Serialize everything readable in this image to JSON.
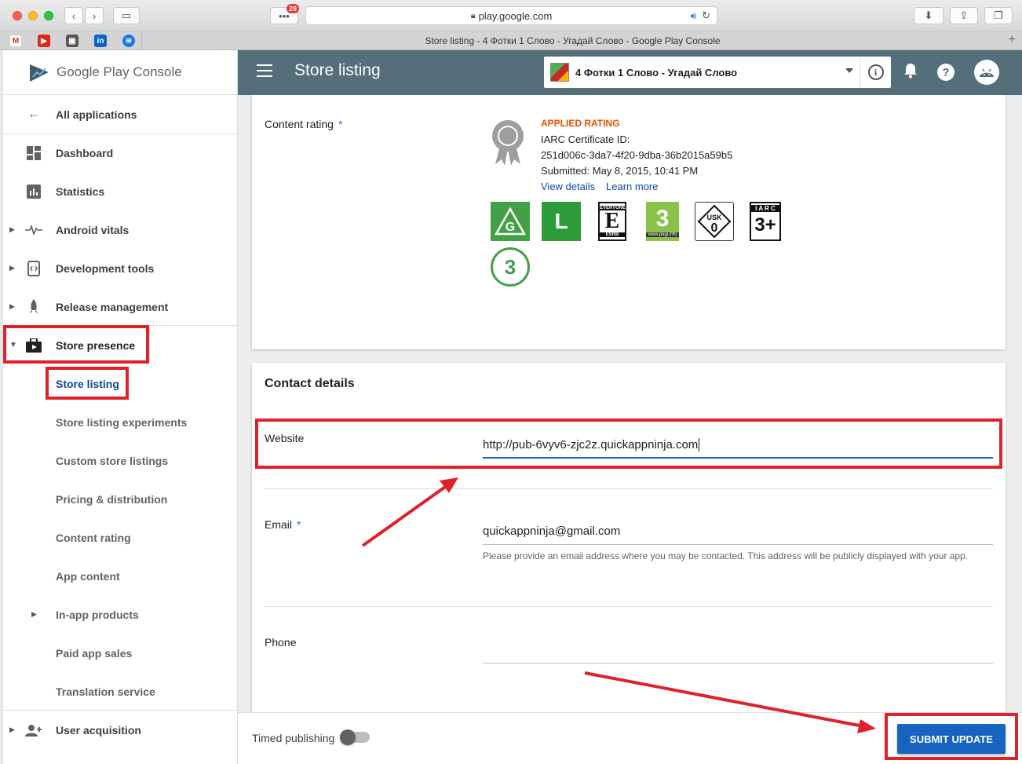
{
  "browser": {
    "url": "play.google.com",
    "tab_title": "Store listing - 4 Фотки 1 Слово - Угадай Слово - Google Play Console",
    "notification_count": "28"
  },
  "brand": {
    "name": "Google Play",
    "suffix": "Console"
  },
  "header": {
    "title": "Store listing",
    "app_name": "4 Фотки 1 Слово - Угадай Слово"
  },
  "sidebar": {
    "items": [
      {
        "label": "All applications"
      },
      {
        "label": "Dashboard"
      },
      {
        "label": "Statistics"
      },
      {
        "label": "Android vitals"
      },
      {
        "label": "Development tools"
      },
      {
        "label": "Release management"
      },
      {
        "label": "Store presence"
      },
      {
        "label": "Store listing"
      },
      {
        "label": "Store listing experiments"
      },
      {
        "label": "Custom store listings"
      },
      {
        "label": "Pricing & distribution"
      },
      {
        "label": "Content rating"
      },
      {
        "label": "App content"
      },
      {
        "label": "In-app products"
      },
      {
        "label": "Paid app sales"
      },
      {
        "label": "Translation service"
      },
      {
        "label": "User acquisition"
      }
    ]
  },
  "content_rating": {
    "label": "Content rating",
    "required_mark": "*",
    "status": "APPLIED RATING",
    "cert_label": "IARC Certificate ID:",
    "cert_id": "251d006c-3da7-4f20-9dba-36b2015a59b5",
    "submitted": "Submitted: May 8, 2015, 10:41 PM",
    "view_details": "View details",
    "learn_more": "Learn more",
    "badges": {
      "g": "G",
      "l": "L",
      "esrb_top": "EVERYONE",
      "esrb_letter": "E",
      "esrb_bottom": "ESRB",
      "pegi": "3",
      "pegi_url": "www.pegi.info",
      "usk_top": "USK",
      "usk_num": "0",
      "iarc_top": "I A R C",
      "iarc_num": "3+",
      "circle": "3"
    }
  },
  "contact": {
    "title": "Contact details",
    "website_label": "Website",
    "website_value": "http://pub-6vyv6-zjc2z.quickappninja.com",
    "email_label": "Email",
    "email_value": "quickappninja@gmail.com",
    "email_hint": "Please provide an email address where you may be contacted. This address will be publicly displayed with your app.",
    "phone_label": "Phone",
    "phone_value": ""
  },
  "footer": {
    "timed_publishing": "Timed publishing",
    "timed_on": false,
    "submit": "SUBMIT UPDATE"
  },
  "colors": {
    "header_bg": "#546e7a",
    "primary": "#1565c0",
    "annotation_red": "#e0202a",
    "applied_rating": "#e65100"
  }
}
